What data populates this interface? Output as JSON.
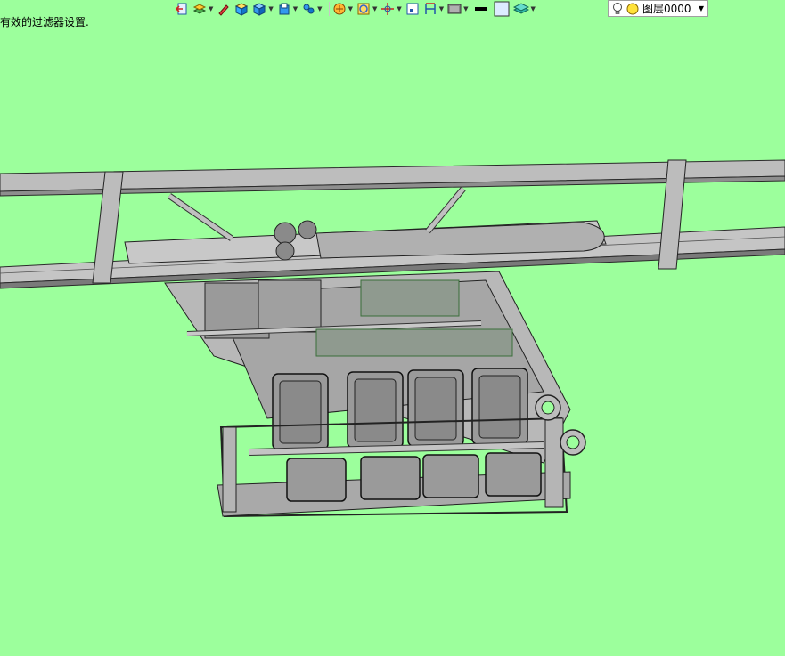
{
  "app": {
    "status_message": "有效的过滤器设置.",
    "background_color": "#9cff9c"
  },
  "toolbar": {
    "items": [
      {
        "name": "exit-icon",
        "has_dropdown": false
      },
      {
        "name": "layers-edit-icon",
        "has_dropdown": true
      },
      {
        "name": "pen-icon",
        "has_dropdown": false
      },
      {
        "name": "solid-box-icon",
        "has_dropdown": false
      },
      {
        "name": "shaded-box-icon",
        "has_dropdown": true
      },
      {
        "name": "view-cube-icon",
        "has_dropdown": true
      },
      {
        "name": "render-options-icon",
        "has_dropdown": true
      },
      {
        "name": "target-circle-icon",
        "has_dropdown": true
      },
      {
        "name": "orientation-icon",
        "has_dropdown": true
      },
      {
        "name": "frame-icon",
        "has_dropdown": false
      },
      {
        "name": "dimension-icon",
        "has_dropdown": true
      },
      {
        "name": "monitor-icon",
        "has_dropdown": true
      },
      {
        "name": "line-weight-icon",
        "has_dropdown": false
      },
      {
        "name": "color-swatch-icon",
        "has_dropdown": false
      },
      {
        "name": "layer-stack-icon",
        "has_dropdown": true
      }
    ]
  },
  "layer_selector": {
    "current_layer": "图层0000",
    "bulb_icon": "lightbulb-icon",
    "status_icon": "yellow-circle-icon"
  },
  "colors": {
    "model_gray": "#c0c0c0",
    "model_dark": "#6e6e6e",
    "edge": "#2a2a2a",
    "accent_green": "#33aa33"
  }
}
